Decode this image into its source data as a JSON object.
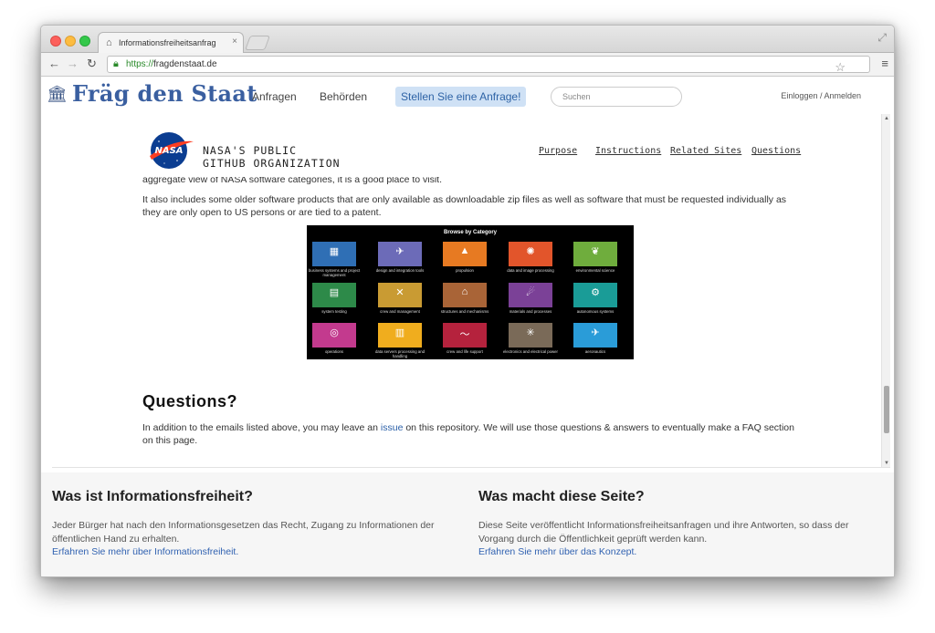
{
  "browser": {
    "tab_title": "Informationsfreiheitsanfrag",
    "tab_close": "×",
    "url_scheme": "https://",
    "url_host": "fragdenstaat.de",
    "back_icon": "arrow-left-icon",
    "forward_icon": "arrow-right-icon",
    "reload_icon": "reload-icon",
    "star_icon": "star-icon",
    "menu_icon": "hamburger-menu-icon"
  },
  "site_header": {
    "logo_text": "Fräg den Staat",
    "nav": [
      "Anfragen",
      "Behörden"
    ],
    "cta_label": "Stellen Sie eine Anfrage!",
    "search_placeholder": "Suchen",
    "login_label": "Einloggen / Anmelden"
  },
  "frame": {
    "brand_line1": "NASA'S PUBLIC",
    "brand_line2": "GITHUB ORGANIZATION",
    "nasa_logo_text": "NASA",
    "nav": [
      "Purpose",
      "Instructions",
      "Related Sites",
      "Questions"
    ],
    "cut_text": "aggregate view of NASA software categories, it is a good place to visit.",
    "paragraph1": "It also includes some older software products that are only available as downloadable zip files as well as software that must be requested individually as they are only open to US persons or are tied to a patent.",
    "category_title": "Browse by Category",
    "categories": [
      {
        "label": "business systems and project management",
        "color": "#2f6fb5",
        "glyph": "▦"
      },
      {
        "label": "design and integration tools",
        "color": "#6c6bb8",
        "glyph": "✈"
      },
      {
        "label": "propulsion",
        "color": "#e77a22",
        "glyph": "▲"
      },
      {
        "label": "data and image processing",
        "color": "#e2552b",
        "glyph": "✺"
      },
      {
        "label": "environmental science",
        "color": "#6fad3d",
        "glyph": "❦"
      },
      {
        "label": "system testing",
        "color": "#2d8a49",
        "glyph": "▤"
      },
      {
        "label": "crew and management",
        "color": "#c99b33",
        "glyph": "✕"
      },
      {
        "label": "structures and mechanisms",
        "color": "#a96437",
        "glyph": "⌂"
      },
      {
        "label": "materials and processes",
        "color": "#7b4197",
        "glyph": "☄"
      },
      {
        "label": "autonomous systems",
        "color": "#1a9c97",
        "glyph": "⚙"
      },
      {
        "label": "operations",
        "color": "#c33a8e",
        "glyph": "◎"
      },
      {
        "label": "data servers processing and handling",
        "color": "#f0ad1e",
        "glyph": "▥"
      },
      {
        "label": "crew and life support",
        "color": "#b5223d",
        "glyph": "〜"
      },
      {
        "label": "electronics and electrical power",
        "color": "#7a6a58",
        "glyph": "✳"
      },
      {
        "label": "aeronautics",
        "color": "#2a9cd8",
        "glyph": "✈"
      }
    ],
    "questions_heading": "Questions?",
    "questions_p_before": "In addition to the emails listed above, you may leave an ",
    "questions_link": "issue",
    "questions_p_after": " on this repository. We will use those questions & answers to eventually make a FAQ section on this page."
  },
  "footer": {
    "left_heading": "Was ist Informationsfreiheit?",
    "left_text": "Jeder Bürger hat nach den Informationsgesetzen das Recht, Zugang zu Informationen der öffentlichen Hand zu erhalten.",
    "left_link": "Erfahren Sie mehr über Informationsfreiheit.",
    "right_heading": "Was macht diese Seite?",
    "right_text": "Diese Seite veröffentlicht Informationsfreiheitsanfragen und ihre Antworten, so dass der Vorgang durch die Öffentlichkeit geprüft werden kann.",
    "right_link": "Erfahren Sie mehr über das Konzept."
  },
  "colors": {
    "brand_blue": "#3a5fa0",
    "cta_bg": "#cfe1f5",
    "link": "#3162b1"
  }
}
